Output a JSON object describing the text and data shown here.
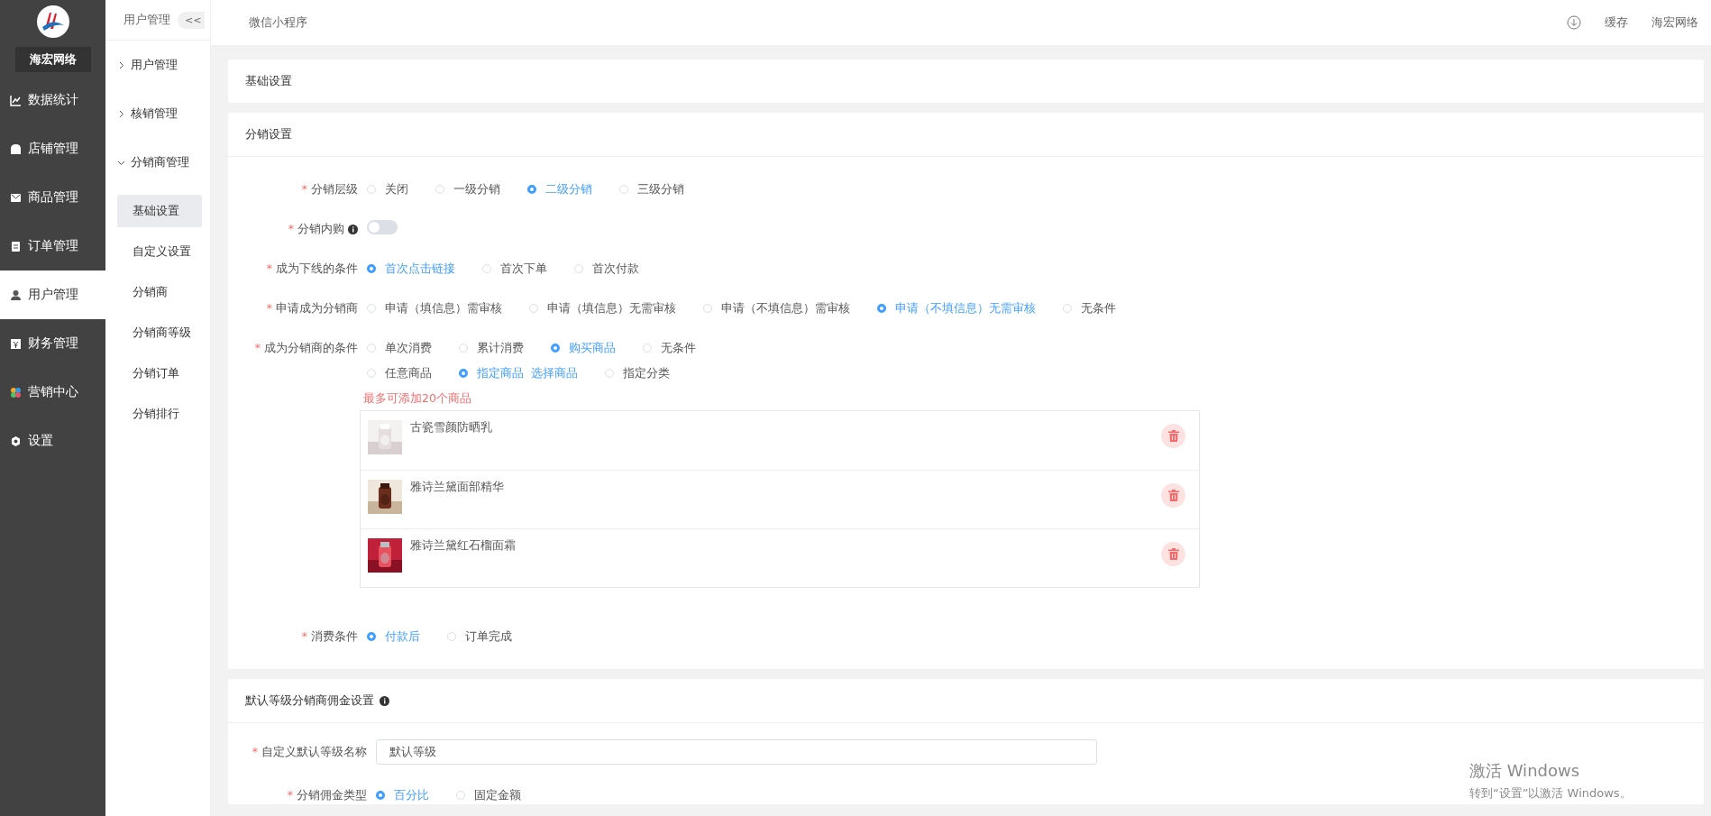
{
  "brand": {
    "name": "海宏网络"
  },
  "main_menu": [
    {
      "label": "数据统计",
      "selected": false
    },
    {
      "label": "店铺管理",
      "selected": false
    },
    {
      "label": "商品管理",
      "selected": false
    },
    {
      "label": "订单管理",
      "selected": false
    },
    {
      "label": "用户管理",
      "selected": true
    },
    {
      "label": "财务管理",
      "selected": false
    },
    {
      "label": "营销中心",
      "selected": false
    },
    {
      "label": "设置",
      "selected": false
    }
  ],
  "sub_menu": {
    "title": "用户管理",
    "collapse": "<<",
    "groups": [
      {
        "label": "用户管理",
        "expanded": false
      },
      {
        "label": "核销管理",
        "expanded": false
      },
      {
        "label": "分销商管理",
        "expanded": true,
        "children": [
          {
            "label": "基础设置",
            "selected": true
          },
          {
            "label": "自定义设置",
            "selected": false
          },
          {
            "label": "分销商",
            "selected": false
          },
          {
            "label": "分销商等级",
            "selected": false
          },
          {
            "label": "分销订单",
            "selected": false
          },
          {
            "label": "分销排行",
            "selected": false
          }
        ]
      }
    ]
  },
  "top_bar": {
    "tab": "微信小程序",
    "cache": "缓存",
    "user": "海宏网络"
  },
  "basic_card": {
    "title": "基础设置"
  },
  "distribution_card": {
    "title": "分销设置",
    "rows": [
      {
        "label": "分销层级",
        "mark": "*",
        "kind": "radio",
        "lines": [
          [
            {
              "label": "关闭",
              "selected": false
            },
            {
              "label": "一级分销",
              "selected": false
            },
            {
              "label": "二级分销",
              "selected": true
            },
            {
              "label": "三级分销",
              "selected": false
            }
          ]
        ]
      },
      {
        "label": "分销内购",
        "mark": "*",
        "kind": "switch",
        "info": true,
        "on": false
      },
      {
        "label": "成为下线的条件",
        "mark": "*",
        "kind": "radio",
        "lines": [
          [
            {
              "label": "首次点击链接",
              "selected": true
            },
            {
              "label": "首次下单",
              "selected": false
            },
            {
              "label": "首次付款",
              "selected": false
            }
          ]
        ]
      },
      {
        "label": "申请成为分销商",
        "mark": "*",
        "kind": "radio",
        "lines": [
          [
            {
              "label": "申请（填信息）需审核",
              "selected": false
            },
            {
              "label": "申请（填信息）无需审核",
              "selected": false
            },
            {
              "label": "申请（不填信息）需审核",
              "selected": false
            },
            {
              "label": "申请（不填信息）无需审核",
              "selected": true
            },
            {
              "label": "无条件",
              "selected": false
            }
          ]
        ]
      },
      {
        "label": "成为分销商的条件",
        "mark": "*",
        "kind": "radio",
        "lines": [
          [
            {
              "label": "单次消费",
              "selected": false
            },
            {
              "label": "累计消费",
              "selected": false
            },
            {
              "label": "购买商品",
              "selected": true
            },
            {
              "label": "无条件",
              "selected": false
            }
          ],
          [
            {
              "label": "任意商品",
              "selected": false
            },
            {
              "label": "指定商品",
              "selected": true,
              "link": "选择商品"
            },
            {
              "label": "指定分类",
              "selected": false
            }
          ]
        ],
        "note": "最多可添加20个商品",
        "products": [
          {
            "name": "古瓷雪颜防晒乳",
            "kind": "picture"
          },
          {
            "name": "雅诗兰黛面部精华",
            "kind": "picture"
          },
          {
            "name": "雅诗兰黛红石榴面霜",
            "kind": "picture"
          }
        ]
      },
      {
        "label": "消费条件",
        "mark": "*",
        "kind": "radio",
        "lines": [
          [
            {
              "label": "付款后",
              "selected": true
            },
            {
              "label": "订单完成",
              "selected": false
            }
          ]
        ]
      }
    ]
  },
  "commission_card": {
    "title": "默认等级分销商佣金设置",
    "rows": [
      {
        "label": "自定义默认等级名称",
        "mark": "*",
        "kind": "input",
        "value": "默认等级"
      },
      {
        "label": "分销佣金类型",
        "mark": "*",
        "kind": "radio",
        "lines": [
          [
            {
              "label": "百分比",
              "selected": true
            },
            {
              "label": "固定金额",
              "selected": false
            }
          ]
        ]
      }
    ]
  },
  "os_notice": {
    "title": "激活 Windows",
    "text": "转到“设置”以激活 Windows。"
  }
}
